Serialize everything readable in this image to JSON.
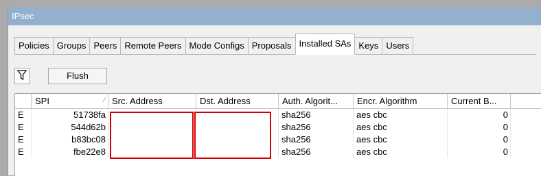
{
  "window": {
    "title": "IPsec"
  },
  "tabs": [
    {
      "label": "Policies"
    },
    {
      "label": "Groups"
    },
    {
      "label": "Peers"
    },
    {
      "label": "Remote Peers"
    },
    {
      "label": "Mode Configs"
    },
    {
      "label": "Proposals"
    },
    {
      "label": "Installed SAs",
      "active": true
    },
    {
      "label": "Keys"
    },
    {
      "label": "Users"
    }
  ],
  "toolbar": {
    "filter_icon": "filter-funnel-icon",
    "flush_label": "Flush"
  },
  "table": {
    "columns": [
      "",
      "SPI",
      "Src. Address",
      "Dst. Address",
      "Auth. Algorit...",
      "Encr. Algorithm",
      "Current B..."
    ],
    "sorted_column": "SPI",
    "rows": [
      {
        "flag": "E",
        "spi": "51738fa",
        "auth": "sha256",
        "encr": "aes cbc",
        "current": "0"
      },
      {
        "flag": "E",
        "spi": "544d62b",
        "auth": "sha256",
        "encr": "aes cbc",
        "current": "0"
      },
      {
        "flag": "E",
        "spi": "b83bc08",
        "auth": "sha256",
        "encr": "aes cbc",
        "current": "0"
      },
      {
        "flag": "E",
        "spi": "fbe22e8",
        "auth": "sha256",
        "encr": "aes cbc",
        "current": "0"
      }
    ]
  },
  "colors": {
    "titlebar": "#94b0cf",
    "redaction": "#d40000"
  }
}
